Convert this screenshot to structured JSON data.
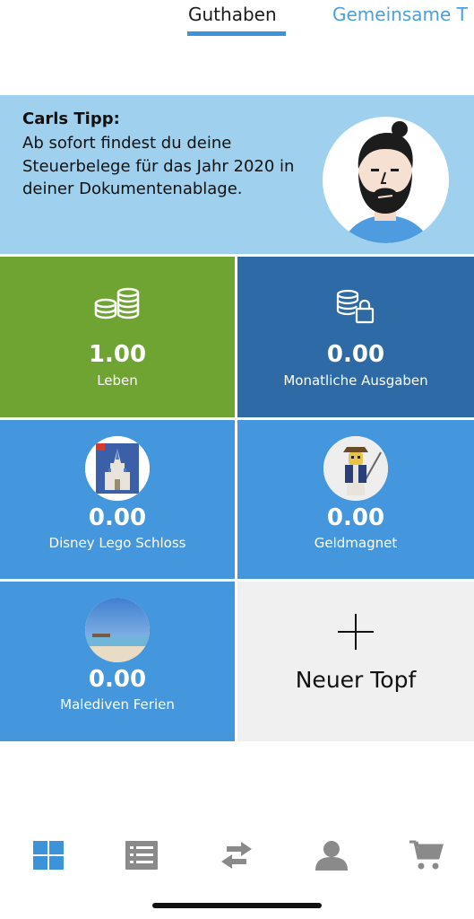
{
  "tabs": [
    {
      "label": "Guthaben",
      "active": true
    },
    {
      "label": "Gemeinsame T",
      "active": false
    }
  ],
  "tip": {
    "title": "Carls Tipp:",
    "text": "Ab sofort findest du deine Steuerbelege für das Jahr 2020 in deiner Dokumentenablage."
  },
  "tiles": [
    {
      "amount": "1.00",
      "label": "Leben",
      "icon": "coins-icon",
      "color": "#6fa433"
    },
    {
      "amount": "0.00",
      "label": "Monatliche Ausgaben",
      "icon": "coins-lock-icon",
      "color": "#2e6ba6"
    },
    {
      "amount": "0.00",
      "label": "Disney Lego Schloss",
      "icon": "castle-photo",
      "color": "#4496dd"
    },
    {
      "amount": "0.00",
      "label": "Geldmagnet",
      "icon": "pirate-photo",
      "color": "#4496dd"
    },
    {
      "amount": "0.00",
      "label": "Malediven Ferien",
      "icon": "beach-photo",
      "color": "#4496dd"
    }
  ],
  "new_pot": {
    "label": "Neuer Topf",
    "icon": "plus-icon"
  },
  "nav": [
    {
      "icon": "grid-icon",
      "active": true
    },
    {
      "icon": "list-icon",
      "active": false
    },
    {
      "icon": "transfer-icon",
      "active": false
    },
    {
      "icon": "person-icon",
      "active": false
    },
    {
      "icon": "cart-icon",
      "active": false
    }
  ],
  "colors": {
    "accent": "#3d93d9",
    "nav_inactive": "#8a8a8a",
    "tip_bg": "#9fd1ee"
  }
}
